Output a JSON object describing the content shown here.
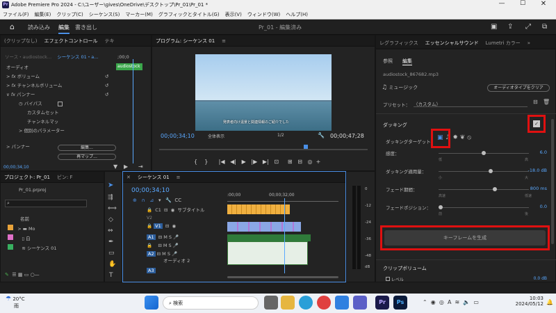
{
  "titlebar": {
    "app_icon": "Pr",
    "title": "Adobe Premiere Pro 2024 - C:\\ユーザー\\gives\\OneDrive\\デスクトップ\\Pr_01\\Pr_01 *"
  },
  "menu": [
    "ファイル(F)",
    "編集(E)",
    "クリップ(C)",
    "シーケンス(S)",
    "マーカー(M)",
    "グラフィックとタイトル(G)",
    "表示(V)",
    "ウィンドウ(W)",
    "ヘルプ(H)"
  ],
  "appbar": {
    "tabs": [
      "読み込み",
      "編集",
      "書き出し"
    ],
    "active_tab": "編集",
    "doc_title": "Pr_01 - 編集済み"
  },
  "effect_panel": {
    "tabs": [
      "(クリップなし)",
      "エフェクトコントロール",
      "テキ"
    ],
    "source_label": "ソース・audiostock...",
    "sequence_label": "シーケンス 01・a...",
    "time_start": ";00;0",
    "clip_label": "audiostock",
    "rows": [
      "オーディオ",
      "ボリューム",
      "チャンネルボリューム",
      "パンナー"
    ],
    "panner": {
      "label": "パンナー",
      "bypass": "バイパス",
      "custom_set": "カスタムセット",
      "custom_set_btn": "編集...",
      "channel_map": "チャンネルマッ",
      "channel_map_btn": "再マップ...",
      "params": "個別のパラメーター"
    },
    "fx_label": "fx",
    "timecode": "00;00;34;10"
  },
  "program_monitor": {
    "title": "プログラム: シーケンス 01",
    "subtitle": "発表者向け遠景と関連情報のご紹介でした",
    "timecode": "00;00;34;10",
    "fit": "全体表示",
    "resolution": "1/2",
    "duration": "00;00;47;28"
  },
  "project_panel": {
    "tabs": [
      "プロジェクト: Pr_01",
      "ビン: F"
    ],
    "file": "Pr_01.prproj",
    "column_name": "名前",
    "items": [
      {
        "name": "Mo",
        "color": "#e8a33a"
      },
      {
        "name": "白",
        "color": "#e070c8"
      },
      {
        "name": "シーケンス 01",
        "color": "#38b060"
      }
    ]
  },
  "timeline": {
    "tab": "シーケンス 01",
    "timecode": "00;00;34;10",
    "ruler": [
      ":00;00",
      "00;00;32;00"
    ],
    "tracks": [
      {
        "name": "C1",
        "label": "サブタイトル"
      },
      {
        "name": "V2",
        "label": ""
      },
      {
        "name": "V1",
        "label": ""
      },
      {
        "name": "A1",
        "label": ""
      },
      {
        "name": "A2",
        "label": "オーディオ 2"
      },
      {
        "name": "A3",
        "label": ""
      }
    ],
    "meter_scale": [
      "0",
      "-12",
      "-24",
      "-36",
      "-48",
      "dB"
    ]
  },
  "essential_sound": {
    "tabs": [
      "レグラフィックス",
      "エッセンシャルサウンド",
      "Lumetri カラー"
    ],
    "subtabs": [
      "参照",
      "編集"
    ],
    "filename": "audiostock_867682.mp3",
    "type_label": "ミュージック",
    "clear_btn": "オーディオタイプをクリア",
    "preset_label": "プリセット：",
    "preset_value": "（カスタム）",
    "ducking_label": "ダッキング",
    "ducking_target": "ダッキングターゲット",
    "sliders": [
      {
        "label": "感度：",
        "value": "6.0",
        "min": "低",
        "max": "高",
        "level": 0.48
      },
      {
        "label": "ダッキング適用量：",
        "value": "-18.0 dB",
        "min": "小",
        "max": "大",
        "level": 0.55
      },
      {
        "label": "フェード期間：",
        "value": "800 ms",
        "min": "高速",
        "max": "低速",
        "level": 0.6
      },
      {
        "label": "フェードポジション：",
        "value": "0.0",
        "min": "前",
        "max": "後",
        "level": 0.0
      }
    ],
    "generate_btn": "キーフレームを生成",
    "clip_volume": "クリップボリューム",
    "level_label": "レベル",
    "level_value": "0.0 dB"
  },
  "taskbar": {
    "weather": "20°C",
    "weather_sub": "雨",
    "search_placeholder": "検索",
    "time": "10:03",
    "date": "2024/05/12"
  }
}
